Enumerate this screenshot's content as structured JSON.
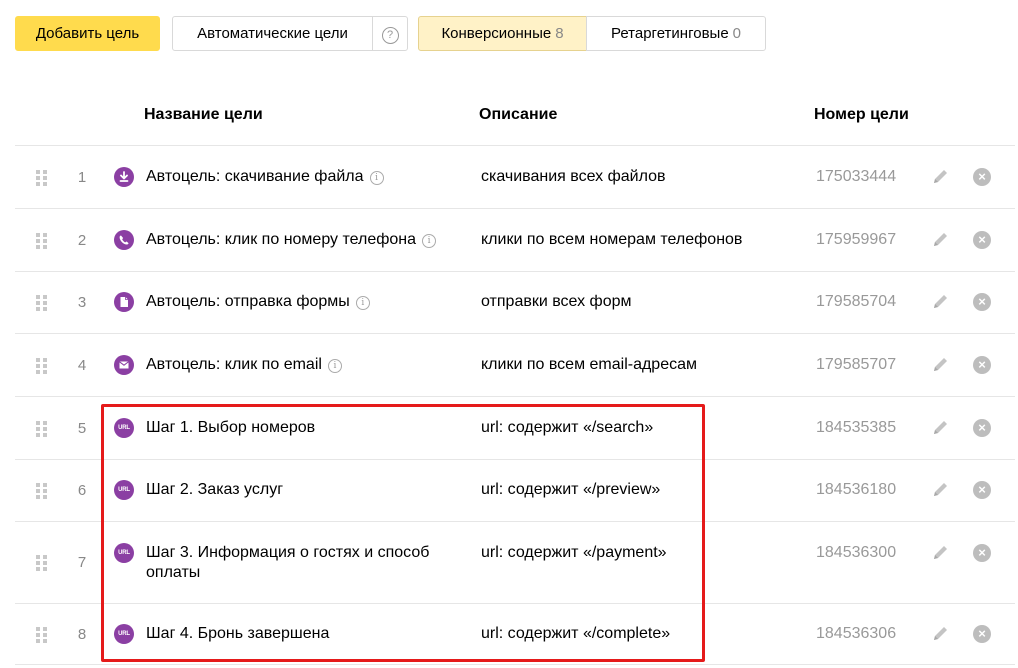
{
  "toolbar": {
    "add_label": "Добавить цель",
    "auto_label": "Автоматические цели",
    "help_label": "?",
    "conv_label": "Конверсионные",
    "conv_count": "8",
    "retarg_label": "Ретаргетинговые",
    "retarg_count": "0"
  },
  "columns": {
    "name": "Название цели",
    "description": "Описание",
    "number": "Номер цели"
  },
  "rows": [
    {
      "index": "1",
      "icon": "download-icon",
      "name": "Автоцель: скачивание файла",
      "info": "i",
      "description": "скачивания всех файлов",
      "number": "175033444"
    },
    {
      "index": "2",
      "icon": "phone-icon",
      "name": "Автоцель: клик по номеру телефона",
      "info": "i",
      "description": "клики по всем номерам телефонов",
      "number": "175959967"
    },
    {
      "index": "3",
      "icon": "form-icon",
      "name": "Автоцель: отправка формы",
      "info": "i",
      "description": "отправки всех форм",
      "number": "179585704"
    },
    {
      "index": "4",
      "icon": "email-icon",
      "name": "Автоцель: клик по email",
      "info": "i",
      "description": "клики по всем email-адресам",
      "number": "179585707"
    },
    {
      "index": "5",
      "icon": "url-icon",
      "icon_text": "URL",
      "name": "Шаг 1. Выбор номеров",
      "description": "url: содержит «/search»",
      "number": "184535385"
    },
    {
      "index": "6",
      "icon": "url-icon",
      "icon_text": "URL",
      "name": "Шаг 2. Заказ услуг",
      "description": "url: содержит «/preview»",
      "number": "184536180"
    },
    {
      "index": "7",
      "icon": "url-icon",
      "icon_text": "URL",
      "name": "Шаг 3. Информация о гостях и способ оплаты",
      "description": "url: содержит «/payment»",
      "number": "184536300"
    },
    {
      "index": "8",
      "icon": "url-icon",
      "icon_text": "URL",
      "name": "Шаг 4. Бронь завершена",
      "description": "url: содержит «/complete»",
      "number": "184536306"
    }
  ],
  "delete_glyph": "×",
  "colors": {
    "accent_yellow": "#ffdb4d",
    "active_tab": "#fff2c7",
    "icon_purple": "#8b3fa3",
    "highlight_red": "#e51a1a"
  }
}
